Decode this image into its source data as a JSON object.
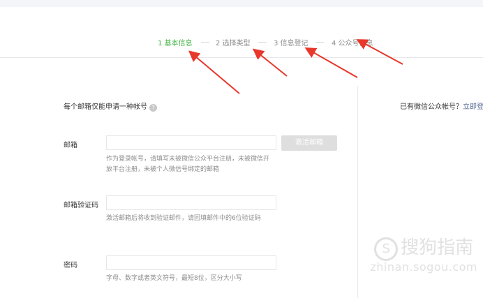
{
  "steps": [
    {
      "label": "1 基本信息",
      "active": true
    },
    {
      "label": "2 选择类型",
      "active": false
    },
    {
      "label": "3 信息登记",
      "active": false
    },
    {
      "label": "4 公众号信息",
      "active": false
    }
  ],
  "form": {
    "notice": "每个邮箱仅能申请一种帐号",
    "help_icon": "?",
    "email": {
      "label": "邮箱",
      "value": "",
      "placeholder": "",
      "activate_button": "激活邮箱",
      "tip": "作为登录帐号，请填写未被微信公众平台注册，未被微信开放平台注册，未被个人微信号绑定的邮箱"
    },
    "verify_code": {
      "label": "邮箱验证码",
      "value": "",
      "placeholder": "",
      "tip": "激活邮箱后将收到验证邮件，请回填邮件中的6位验证码"
    },
    "password": {
      "label": "密码",
      "value": "",
      "placeholder": "",
      "tip": "字母、数字或者英文符号，最短8位，区分大小写"
    }
  },
  "sidebar": {
    "prompt": "已有微信公众帐号？",
    "login_link": "立即登"
  },
  "watermark": {
    "logo_char": "S",
    "title": "搜狗指南",
    "subtitle": "zhinan.sogou.com"
  },
  "colors": {
    "active_step": "#44b549",
    "inactive_step": "#8d8d8d",
    "arrow": "#e8372b",
    "link": "#576b95",
    "disabled_button": "#dedede"
  }
}
